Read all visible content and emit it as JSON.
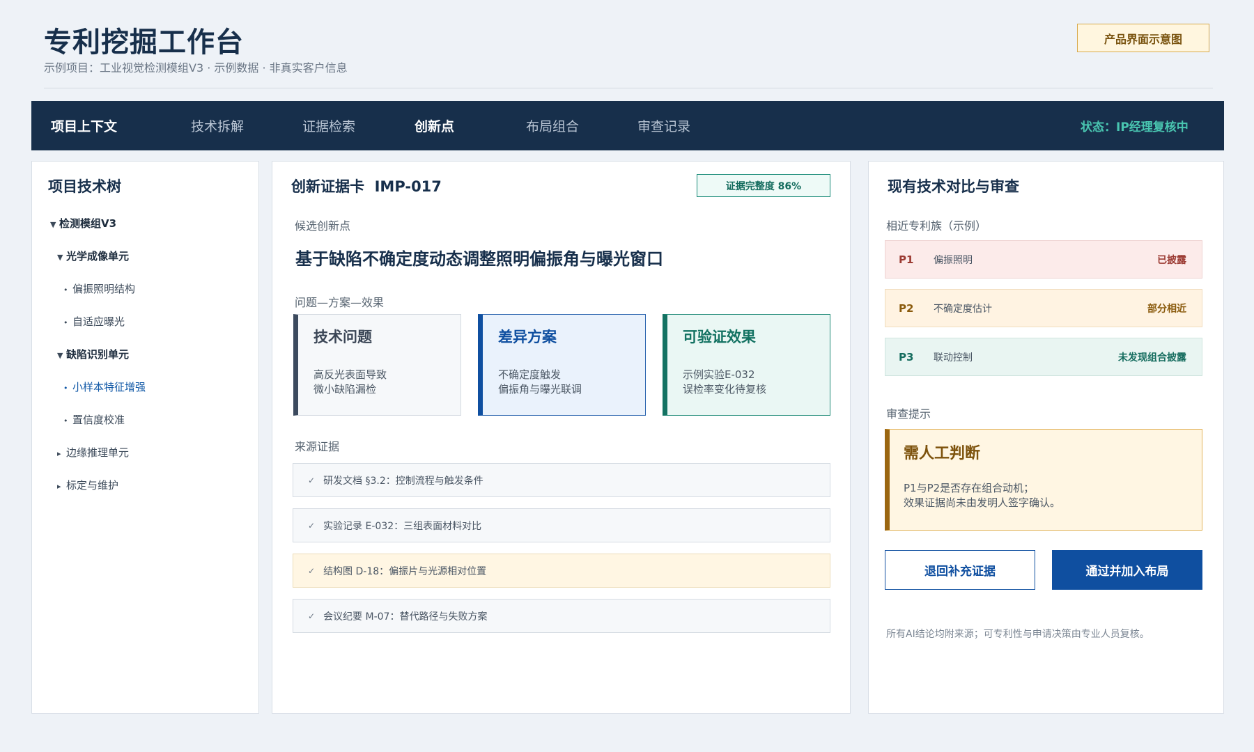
{
  "header": {
    "title": "专利挖掘工作台",
    "subtitle": "示例项目：工业视觉检测模组V3 · 示例数据 · 非真实客户信息",
    "badge": "产品界面示意图"
  },
  "nav": {
    "items": [
      {
        "label": "项目上下文"
      },
      {
        "label": "技术拆解"
      },
      {
        "label": "证据检索"
      },
      {
        "label": "创新点"
      },
      {
        "label": "布局组合"
      },
      {
        "label": "审查记录"
      }
    ],
    "status": "状态：IP经理复核中"
  },
  "tree": {
    "title": "项目技术树",
    "items": [
      {
        "arrow": "▼",
        "label": "检测模组V3"
      },
      {
        "arrow": "▼",
        "label": "光学成像单元"
      },
      {
        "arrow": "•",
        "label": "偏振照明结构"
      },
      {
        "arrow": "•",
        "label": "自适应曝光"
      },
      {
        "arrow": "▼",
        "label": "缺陷识别单元"
      },
      {
        "arrow": "•",
        "label": "小样本特征增强"
      },
      {
        "arrow": "•",
        "label": "置信度校准"
      },
      {
        "arrow": "▸",
        "label": "边缘推理单元"
      },
      {
        "arrow": "▸",
        "label": "标定与维护"
      }
    ]
  },
  "card": {
    "title": "创新证据卡  IMP-017",
    "completeness": "证据完整度 86%",
    "candidate_label": "候选创新点",
    "candidate": "基于缺陷不确定度动态调整照明偏振角与曝光窗口",
    "pse_label": "问题—方案—效果",
    "problem": {
      "title": "技术问题",
      "body": "高反光表面导致\n微小缺陷漏检"
    },
    "solution": {
      "title": "差异方案",
      "body": "不确定度触发\n偏振角与曝光联调"
    },
    "effect": {
      "title": "可验证效果",
      "body": "示例实验E-032\n误检率变化待复核"
    },
    "evidence_label": "来源证据",
    "evidence": [
      {
        "check": "✓",
        "text": "研发文档 §3.2：控制流程与触发条件"
      },
      {
        "check": "✓",
        "text": "实验记录 E-032：三组表面材料对比"
      },
      {
        "check": "✓",
        "text": "结构图 D-18：偏振片与光源相对位置"
      },
      {
        "check": "✓",
        "text": "会议纪要 M-07：替代路径与失败方案"
      }
    ]
  },
  "compare": {
    "title": "现有技术对比与审查",
    "family_label": "相近专利族（示例）",
    "patents": [
      {
        "id": "P1",
        "name": "偏振照明",
        "status": "已披露"
      },
      {
        "id": "P2",
        "name": "不确定度估计",
        "status": "部分相近"
      },
      {
        "id": "P3",
        "name": "联动控制",
        "status": "未发现组合披露"
      }
    ],
    "review_label": "审查提示",
    "review_title": "需人工判断",
    "review_body": "P1与P2是否存在组合动机；\n效果证据尚未由发明人签字确认。",
    "btn_back": "退回补充证据",
    "btn_approve": "通过并加入布局",
    "footnote": "所有AI结论均附来源；可专利性与申请决策由专业人员复核。"
  }
}
